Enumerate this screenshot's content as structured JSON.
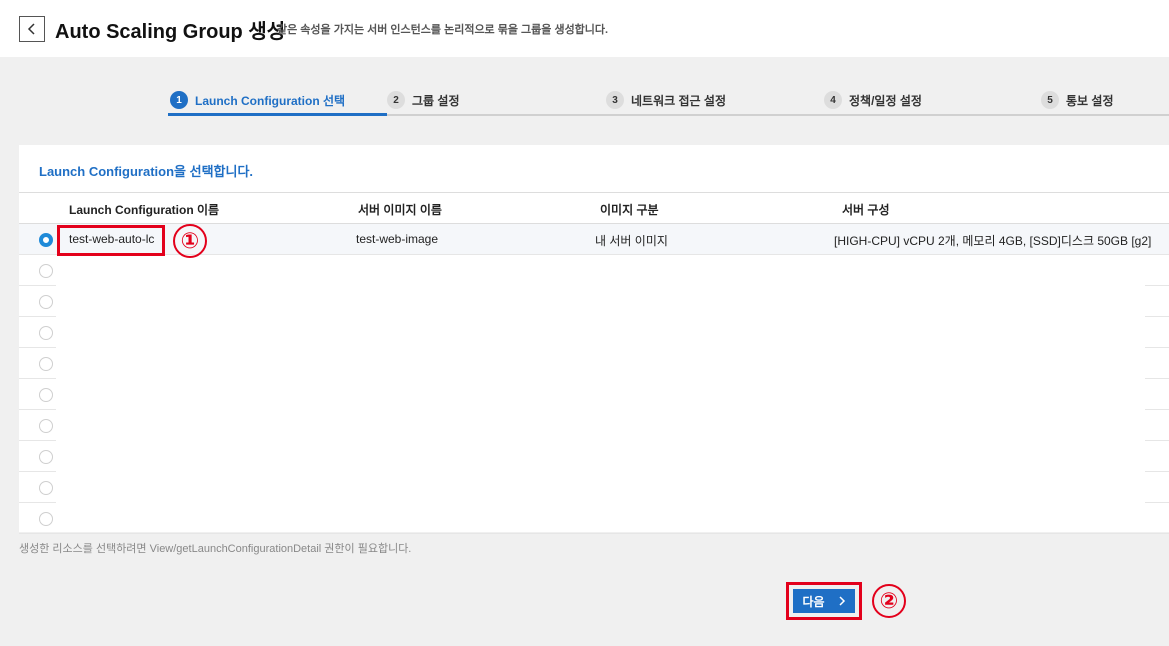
{
  "header": {
    "title": "Auto Scaling Group 생성",
    "description": "같은 속성을 가지는 서버 인스턴스를 논리적으로 묶을 그룹을 생성합니다."
  },
  "steps": [
    {
      "num": "1",
      "label": "Launch Configuration 선택"
    },
    {
      "num": "2",
      "label": "그룹 설정"
    },
    {
      "num": "3",
      "label": "네트워크 접근 설정"
    },
    {
      "num": "4",
      "label": "정책/일정 설정"
    },
    {
      "num": "5",
      "label": "통보 설정"
    }
  ],
  "panel": {
    "title": "Launch Configuration을 선택합니다."
  },
  "table": {
    "columns": [
      "Launch Configuration 이름",
      "서버 이미지 이름",
      "이미지 구분",
      "서버 구성"
    ],
    "rows": [
      {
        "name": "test-web-auto-lc",
        "image_name": "test-web-image",
        "image_type": "내 서버 이미지",
        "spec": "[HIGH-CPU] vCPU 2개, 메모리 4GB, [SSD]디스크 50GB [g2]"
      }
    ]
  },
  "annotations": {
    "marker1": "①",
    "marker2": "②"
  },
  "footer_note": "생성한 리소스를 선택하려면 View/getLaunchConfigurationDetail 권한이 필요합니다.",
  "next_button": {
    "label": "다음",
    "icon": "chevron-right-icon"
  },
  "colors": {
    "accent": "#1f6fc5",
    "annotation": "#e3001b"
  }
}
